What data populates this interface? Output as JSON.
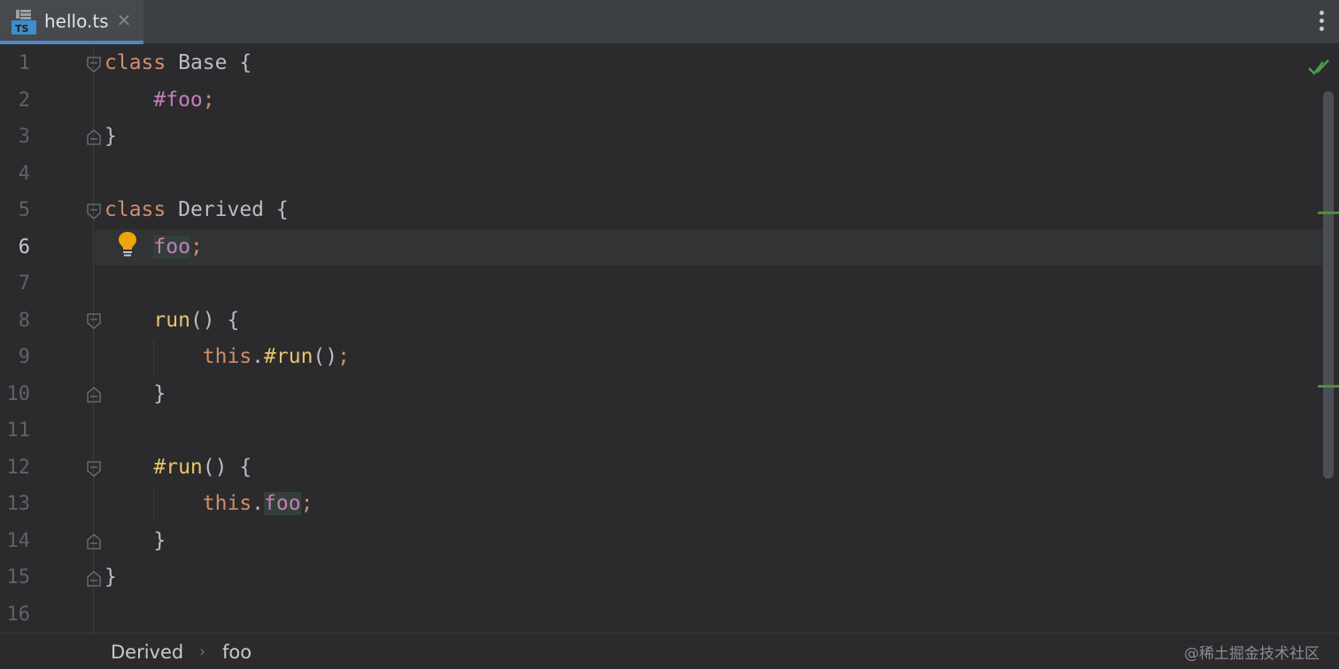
{
  "tab": {
    "file_name": "hello.ts",
    "icon": "typescript-file-icon",
    "icon_text": "TS",
    "close_glyph": "✕",
    "accent_color": "#4a88c7"
  },
  "editor": {
    "active_line": 6,
    "line_numbers": [
      "1",
      "2",
      "3",
      "4",
      "5",
      "6",
      "7",
      "8",
      "9",
      "10",
      "11",
      "12",
      "13",
      "14",
      "15",
      "16"
    ],
    "lines": [
      {
        "kw": "class",
        "rest": " Base {"
      },
      {
        "indent": "    ",
        "pv": "#foo",
        "semi": ";"
      },
      {
        "text": "}"
      },
      {
        "text": ""
      },
      {
        "kw": "class",
        "rest": " Derived {"
      },
      {
        "indent": "    ",
        "pv": "foo",
        "semi": ";"
      },
      {
        "text": ""
      },
      {
        "indent": "    ",
        "fn": "run",
        "rest": "() {"
      },
      {
        "indent": "        ",
        "kw": "this",
        "dot": ".",
        "fn": "#run",
        "rest": "()",
        "semi": ";"
      },
      {
        "indent": "    ",
        "text": "}"
      },
      {
        "text": ""
      },
      {
        "indent": "    ",
        "fn": "#run",
        "rest": "() {"
      },
      {
        "indent": "        ",
        "kw": "this",
        "dot": ".",
        "pv": "foo",
        "semi": ";"
      },
      {
        "indent": "    ",
        "text": "}"
      },
      {
        "text": "}"
      },
      {
        "text": ""
      }
    ],
    "inspection_status_icon": "check-icon",
    "intention_icon": "lightbulb-icon"
  },
  "breadcrumbs": {
    "items": [
      "Derived",
      "foo"
    ],
    "separator": "›"
  },
  "watermark": "@稀土掘金技术社区"
}
